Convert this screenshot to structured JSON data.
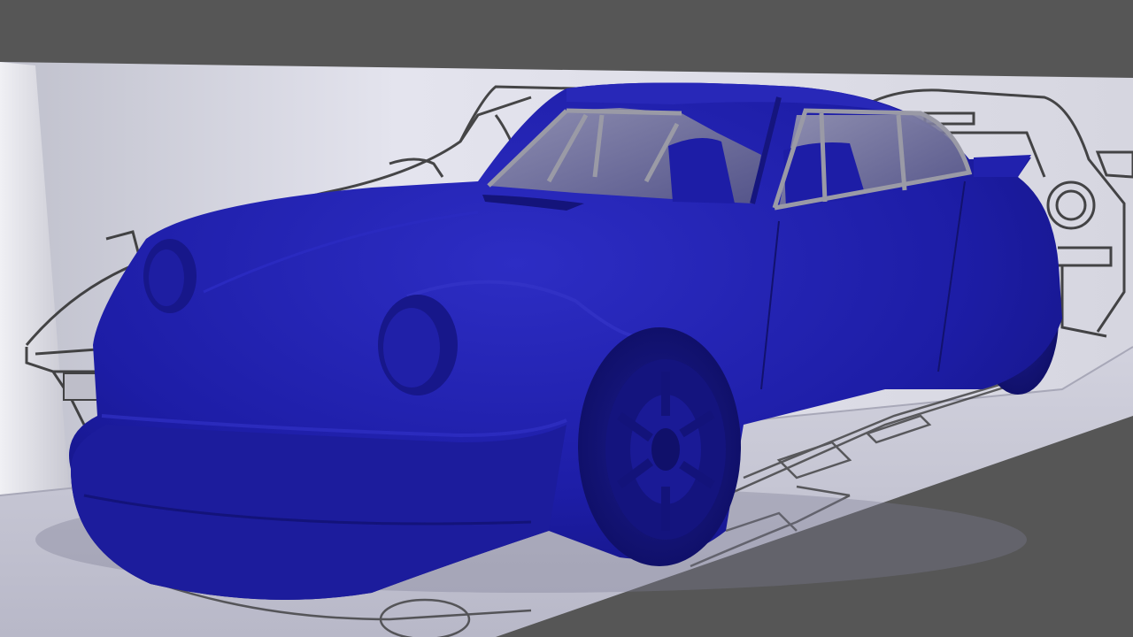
{
  "viewport": {
    "background_color": "#565656",
    "wall_color": "#d8d8e2",
    "floor_color": "#c9c9d6",
    "car_body_color": "#1f1fa0",
    "car_shadow_color": "#12126e",
    "car_highlight_color": "#3a3ad0",
    "rollcage_color": "#9a9aa6",
    "sketch_line_color": "#2a2a2a"
  }
}
